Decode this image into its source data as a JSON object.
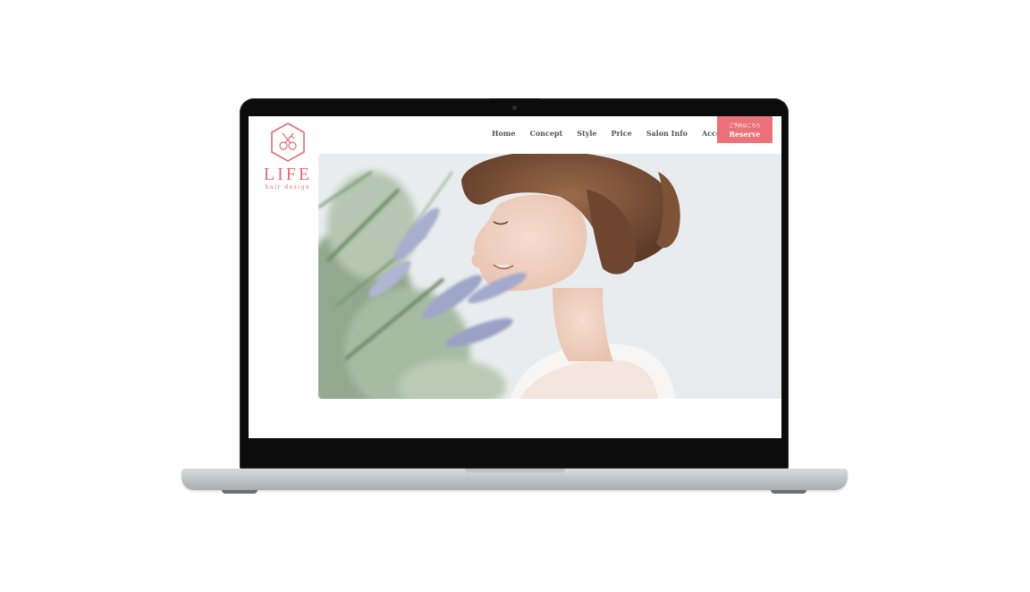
{
  "site": {
    "logo_name": "LIFE",
    "logo_sub": "hair design"
  },
  "nav": {
    "items": [
      "Home",
      "Concept",
      "Style",
      "Price",
      "Salon Info",
      "Access"
    ],
    "reserve_small": "ご予約はこちら",
    "reserve_label": "Reserve"
  },
  "colors": {
    "accent": "#ec727a",
    "nav_text": "#555555"
  },
  "hero": {
    "image": "woman-with-lavender-photo"
  }
}
